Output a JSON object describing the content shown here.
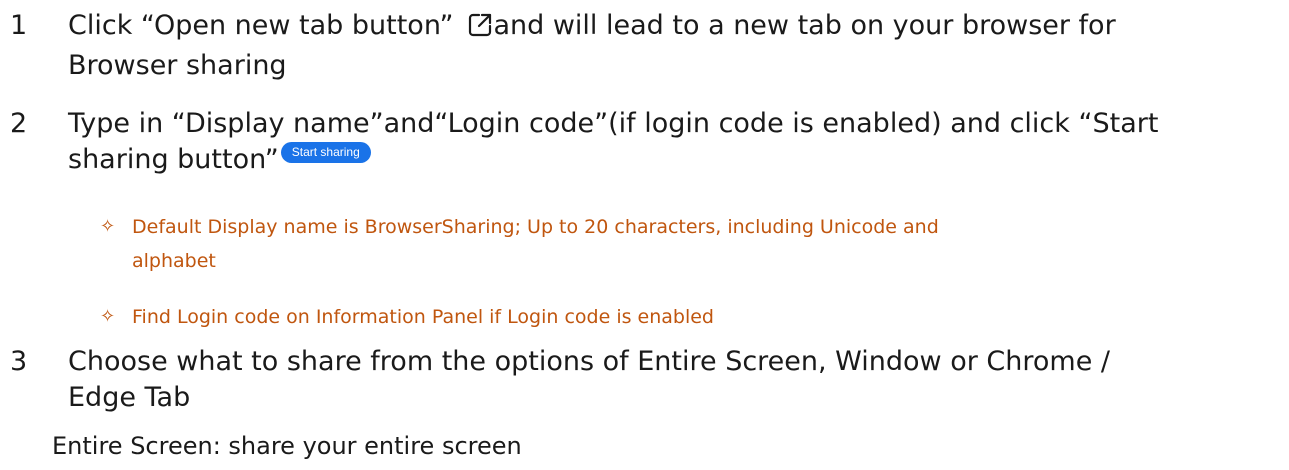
{
  "steps": [
    {
      "number": "1",
      "line1_before_icon": "Click “Open new tab button”",
      "line1_after_icon": "and will lead to a new tab on your browser for",
      "line2": "Browser sharing",
      "icon": "open-new-tab-icon"
    },
    {
      "number": "2",
      "line1": "Type in “Display name”and“Login code”(if login code is enabled) and click “Start",
      "line2": "sharing button”",
      "button_label": "Start sharing",
      "bullets": [
        {
          "line1": "Default Display name is BrowserSharing; Up to 20 characters, including Unicode and",
          "line2": "alphabet"
        },
        {
          "line1": "Find Login code on Information Panel if Login code is enabled"
        }
      ]
    },
    {
      "number": "3",
      "line1": "Choose what to share from the options of Entire Screen, Window or Chrome /",
      "line2": "Edge Tab",
      "sub_line": "Entire Screen: share your entire screen"
    }
  ],
  "colors": {
    "text": "#1a1a1a",
    "bullet_text": "#c0560f",
    "button_bg": "#1a73e8",
    "button_text": "#ffffff"
  },
  "bullet_icon": "four-point-star-outline-icon"
}
